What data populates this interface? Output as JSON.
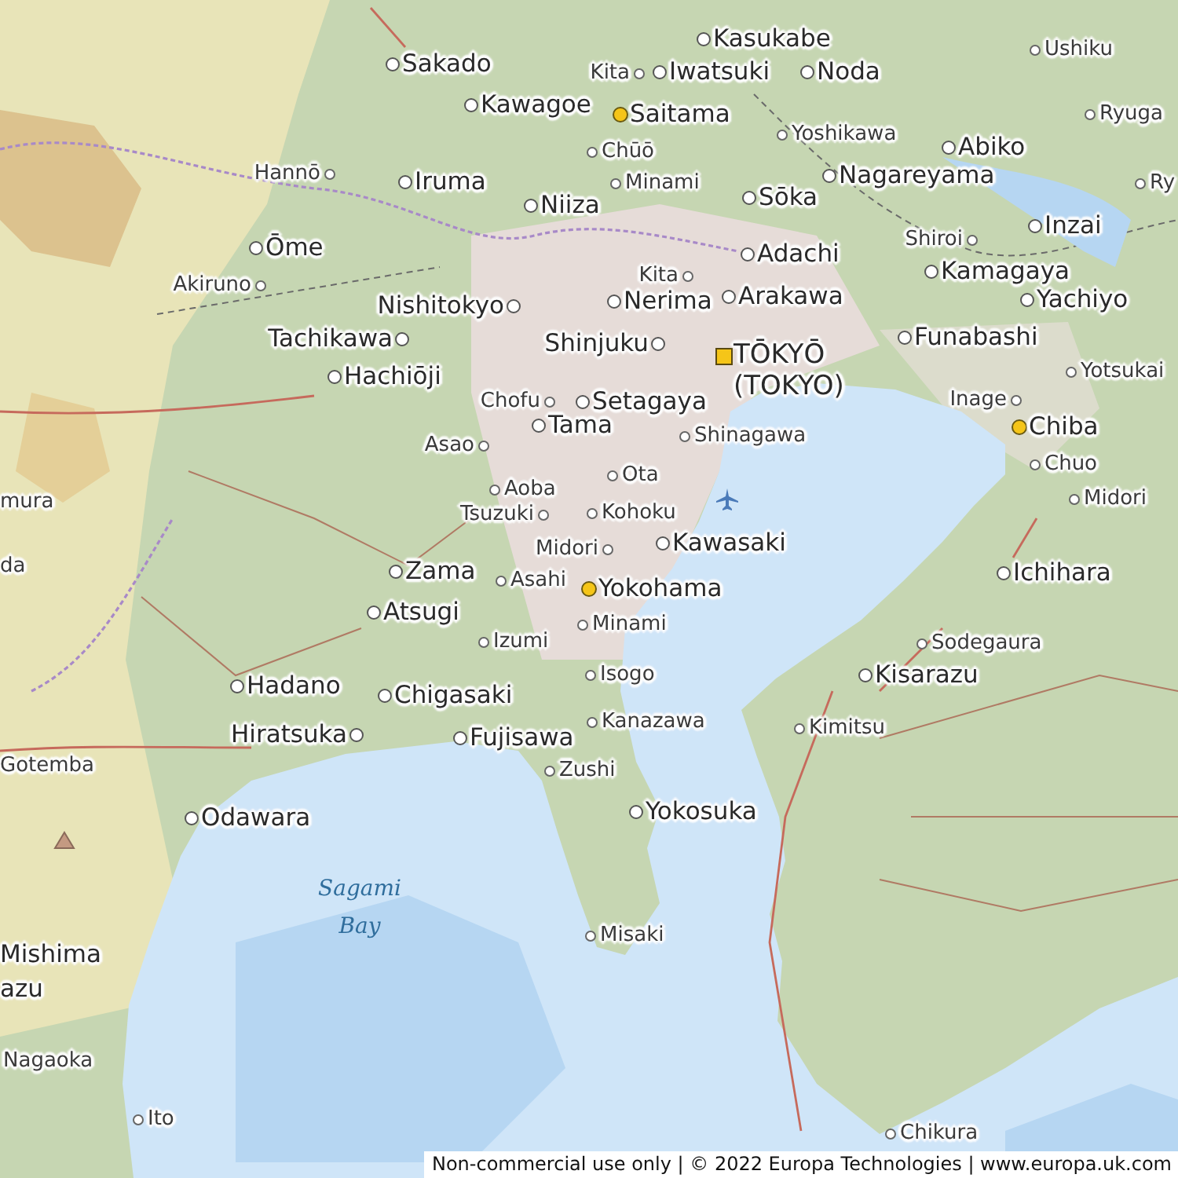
{
  "map": {
    "places": [
      {
        "name": "Kasukabe",
        "kind": "city"
      },
      {
        "name": "Ushiku",
        "kind": "town"
      },
      {
        "name": "Sakado",
        "kind": "city"
      },
      {
        "name": "Kita",
        "kind": "town"
      },
      {
        "name": "Iwatsuki",
        "kind": "city"
      },
      {
        "name": "Noda",
        "kind": "city"
      },
      {
        "name": "Kawagoe",
        "kind": "city"
      },
      {
        "name": "Saitama",
        "kind": "prefecture_capital"
      },
      {
        "name": "Ryuga",
        "kind": "town"
      },
      {
        "name": "Yoshikawa",
        "kind": "town"
      },
      {
        "name": "Abiko",
        "kind": "city"
      },
      {
        "name": "Hannō",
        "kind": "town"
      },
      {
        "name": "Iruma",
        "kind": "city"
      },
      {
        "name": "Chūō",
        "kind": "town"
      },
      {
        "name": "Minami",
        "kind": "town"
      },
      {
        "name": "Nagareyama",
        "kind": "city"
      },
      {
        "name": "Ry",
        "kind": "town"
      },
      {
        "name": "Niiza",
        "kind": "city"
      },
      {
        "name": "Sōka",
        "kind": "city"
      },
      {
        "name": "Shiroi",
        "kind": "town"
      },
      {
        "name": "Inzai",
        "kind": "city"
      },
      {
        "name": "Ōme",
        "kind": "city"
      },
      {
        "name": "Adachi",
        "kind": "city"
      },
      {
        "name": "Kamagaya",
        "kind": "city"
      },
      {
        "name": "Akiruno",
        "kind": "town"
      },
      {
        "name": "Kita",
        "kind": "town"
      },
      {
        "name": "Nerima",
        "kind": "city"
      },
      {
        "name": "Arakawa",
        "kind": "city"
      },
      {
        "name": "Nishitokyo",
        "kind": "city"
      },
      {
        "name": "Yachiyo",
        "kind": "city"
      },
      {
        "name": "Tachikawa",
        "kind": "city"
      },
      {
        "name": "Shinjuku",
        "kind": "city"
      },
      {
        "name": "TŌKYŌ",
        "alt_name": "(TOKYO)",
        "kind": "capital"
      },
      {
        "name": "Funabashi",
        "kind": "city"
      },
      {
        "name": "Hachiōji",
        "kind": "city"
      },
      {
        "name": "Yotsukai",
        "kind": "town"
      },
      {
        "name": "Chofu",
        "kind": "town"
      },
      {
        "name": "Setagaya",
        "kind": "city"
      },
      {
        "name": "Inage",
        "kind": "town"
      },
      {
        "name": "Tama",
        "kind": "city"
      },
      {
        "name": "Chiba",
        "kind": "prefecture_capital"
      },
      {
        "name": "Shinagawa",
        "kind": "town"
      },
      {
        "name": "Asao",
        "kind": "town"
      },
      {
        "name": "Chuo",
        "kind": "town"
      },
      {
        "name": "Ota",
        "kind": "town"
      },
      {
        "name": "Aoba",
        "kind": "town"
      },
      {
        "name": "Midori",
        "kind": "town"
      },
      {
        "name": "Tsuzuki",
        "kind": "town"
      },
      {
        "name": "Kohoku",
        "kind": "town"
      },
      {
        "name": "Kawasaki",
        "kind": "city"
      },
      {
        "name": "Midori",
        "kind": "town"
      },
      {
        "name": "Zama",
        "kind": "city"
      },
      {
        "name": "Asahi",
        "kind": "town"
      },
      {
        "name": "Yokohama",
        "kind": "prefecture_capital"
      },
      {
        "name": "Ichihara",
        "kind": "city"
      },
      {
        "name": "Atsugi",
        "kind": "city"
      },
      {
        "name": "Minami",
        "kind": "town"
      },
      {
        "name": "Sodegaura",
        "kind": "town"
      },
      {
        "name": "Izumi",
        "kind": "town"
      },
      {
        "name": "Kisarazu",
        "kind": "city"
      },
      {
        "name": "Hadano",
        "kind": "city"
      },
      {
        "name": "Chigasaki",
        "kind": "city"
      },
      {
        "name": "Isogo",
        "kind": "town"
      },
      {
        "name": "Hiratsuka",
        "kind": "city"
      },
      {
        "name": "Fujisawa",
        "kind": "city"
      },
      {
        "name": "Kanazawa",
        "kind": "town"
      },
      {
        "name": "Kimitsu",
        "kind": "town"
      },
      {
        "name": "Gotemba",
        "kind": "edge_label"
      },
      {
        "name": "Zushi",
        "kind": "town"
      },
      {
        "name": "Odawara",
        "kind": "city"
      },
      {
        "name": "Yokosuka",
        "kind": "city"
      },
      {
        "name": "Misaki",
        "kind": "town"
      },
      {
        "name": "Mishima",
        "kind": "edge_label_large"
      },
      {
        "name": "azu",
        "kind": "edge_label_large"
      },
      {
        "name": "Nagaoka",
        "kind": "edge_label"
      },
      {
        "name": "Ito",
        "kind": "town"
      },
      {
        "name": "Chikura",
        "kind": "town"
      },
      {
        "name": "mura",
        "kind": "edge_label"
      },
      {
        "name": "da",
        "kind": "edge_label"
      }
    ],
    "sea_label": "Sagami Bay",
    "attribution": "Non-commercial use only | © 2022 Europa Technologies | www.europa.uk.com"
  }
}
